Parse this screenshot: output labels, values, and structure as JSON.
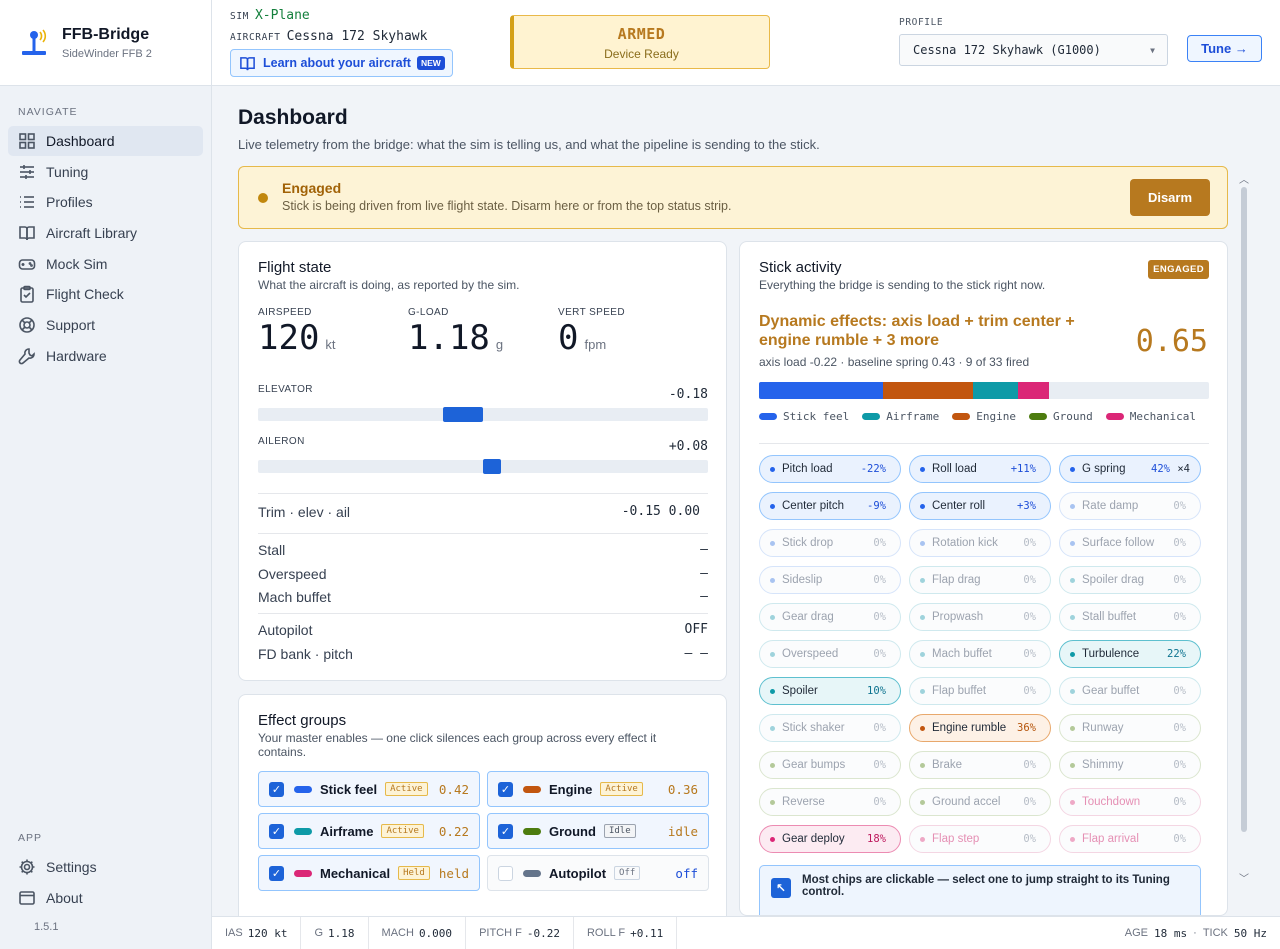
{
  "brand": {
    "title": "FFB-Bridge",
    "subtitle": "SideWinder FFB 2"
  },
  "nav": {
    "heading": "NAVIGATE",
    "items": [
      {
        "label": "Dashboard",
        "icon": "dashboard-icon"
      },
      {
        "label": "Tuning",
        "icon": "sliders-icon"
      },
      {
        "label": "Profiles",
        "icon": "list-icon"
      },
      {
        "label": "Aircraft Library",
        "icon": "book-icon"
      },
      {
        "label": "Mock Sim",
        "icon": "gamepad-icon"
      },
      {
        "label": "Flight Check",
        "icon": "clipboard-icon"
      },
      {
        "label": "Support",
        "icon": "lifebuoy-icon"
      },
      {
        "label": "Hardware",
        "icon": "wrench-icon"
      }
    ],
    "app_heading": "APP",
    "app_items": [
      {
        "label": "Settings",
        "icon": "gear-icon"
      },
      {
        "label": "About",
        "icon": "window-icon"
      }
    ],
    "version": "1.5.1"
  },
  "header": {
    "sim_key": "SIM",
    "sim_value": "X-Plane",
    "aircraft_key": "AIRCRAFT",
    "aircraft_value": "Cessna 172 Skyhawk",
    "learn_label": "Learn about your aircraft",
    "learn_badge": "NEW",
    "armed_title": "ARMED",
    "armed_sub": "Device Ready",
    "profile_label": "PROFILE",
    "profile_value": "Cessna 172 Skyhawk (G1000)",
    "tune_label": "Tune →"
  },
  "page": {
    "title": "Dashboard",
    "subtitle": "Live telemetry from the bridge: what the sim is telling us, and what the pipeline is sending to the stick."
  },
  "engaged": {
    "title": "Engaged",
    "sub": "Stick is being driven from live flight state. Disarm here or from the top status strip.",
    "button": "Disarm"
  },
  "flight_state": {
    "title": "Flight state",
    "sub": "What the aircraft is doing, as reported by the sim.",
    "airspeed": {
      "label": "AIRSPEED",
      "value": "120",
      "unit": "kt"
    },
    "gload": {
      "label": "G-LOAD",
      "value": "1.18",
      "unit": "g"
    },
    "vs": {
      "label": "VERT SPEED",
      "value": "0",
      "unit": "fpm"
    },
    "elevator": {
      "label": "ELEVATOR",
      "value": "-0.18",
      "pos": -0.18
    },
    "aileron": {
      "label": "AILERON",
      "value": "+0.08",
      "pos": 0.08
    },
    "trim": {
      "label": "Trim · elev · ail",
      "value": "-0.15 0.00"
    },
    "stall": {
      "label": "Stall",
      "value": "—"
    },
    "overspeed": {
      "label": "Overspeed",
      "value": "—"
    },
    "mach": {
      "label": "Mach buffet",
      "value": "—"
    },
    "autopilot": {
      "label": "Autopilot",
      "value": "OFF"
    },
    "fd": {
      "label": "FD bank · pitch",
      "value": "— —"
    }
  },
  "effect_groups": {
    "title": "Effect groups",
    "sub": "Your master enables — one click silences each group across every effect it contains.",
    "items": [
      {
        "name": "Stick feel",
        "badge": "Active",
        "value": "0.42",
        "color": "#2563eb",
        "checked": true
      },
      {
        "name": "Engine",
        "badge": "Active",
        "value": "0.36",
        "color": "#c2560f",
        "checked": true
      },
      {
        "name": "Airframe",
        "badge": "Active",
        "value": "0.22",
        "color": "#0e9aa7",
        "checked": true
      },
      {
        "name": "Ground",
        "badge": "Idle",
        "value": "idle",
        "color": "#4d7c0f",
        "checked": true
      },
      {
        "name": "Mechanical",
        "badge": "Held",
        "value": "held",
        "color": "#db2777",
        "checked": true
      },
      {
        "name": "Autopilot",
        "badge": "Off",
        "value": "off",
        "color": "#64748b",
        "checked": false
      }
    ]
  },
  "stick_activity": {
    "title": "Stick activity",
    "sub": "Everything the bridge is sending to the stick right now.",
    "badge": "ENGAGED",
    "dynamic_title": "Dynamic effects: axis load + trim center + engine rumble + 3 more",
    "dynamic_value": "0.65",
    "dynamic_sub": "axis load -0.22 · baseline spring 0.43 · 9 of 33 fired",
    "bar": [
      {
        "group": "Stick feel",
        "fraction": 0.275,
        "color": "#2563eb"
      },
      {
        "group": "Engine",
        "fraction": 0.2,
        "color": "#c2560f"
      },
      {
        "group": "Airframe",
        "fraction": 0.1,
        "color": "#0e9aa7"
      },
      {
        "group": "Mechanical",
        "fraction": 0.07,
        "color": "#db2777"
      }
    ],
    "legend": [
      {
        "label": "Stick feel",
        "color": "#2563eb"
      },
      {
        "label": "Airframe",
        "color": "#0e9aa7"
      },
      {
        "label": "Engine",
        "color": "#c2560f"
      },
      {
        "label": "Ground",
        "color": "#4d7c0f"
      },
      {
        "label": "Mechanical",
        "color": "#db2777"
      }
    ],
    "chips": [
      {
        "name": "Pitch load",
        "value": "-22%",
        "group": "stick",
        "on": true
      },
      {
        "name": "Roll load",
        "value": "+11%",
        "group": "stick",
        "on": true
      },
      {
        "name": "G spring",
        "value": "42%",
        "mult": "×4",
        "group": "stick",
        "on": true
      },
      {
        "name": "Center pitch",
        "value": "-9%",
        "group": "stick",
        "on": true
      },
      {
        "name": "Center roll",
        "value": "+3%",
        "group": "stick",
        "on": true
      },
      {
        "name": "Rate damp",
        "value": "0%",
        "group": "stick",
        "on": false
      },
      {
        "name": "Stick drop",
        "value": "0%",
        "group": "stick",
        "on": false
      },
      {
        "name": "Rotation kick",
        "value": "0%",
        "group": "stick",
        "on": false
      },
      {
        "name": "Surface follow",
        "value": "0%",
        "group": "stick",
        "on": false
      },
      {
        "name": "Sideslip",
        "value": "0%",
        "group": "stick",
        "on": false
      },
      {
        "name": "Flap drag",
        "value": "0%",
        "group": "air",
        "on": false
      },
      {
        "name": "Spoiler drag",
        "value": "0%",
        "group": "air",
        "on": false
      },
      {
        "name": "Gear drag",
        "value": "0%",
        "group": "air",
        "on": false
      },
      {
        "name": "Propwash",
        "value": "0%",
        "group": "air",
        "on": false
      },
      {
        "name": "Stall buffet",
        "value": "0%",
        "group": "air",
        "on": false
      },
      {
        "name": "Overspeed",
        "value": "0%",
        "group": "air",
        "on": false
      },
      {
        "name": "Mach buffet",
        "value": "0%",
        "group": "air",
        "on": false
      },
      {
        "name": "Turbulence",
        "value": "22%",
        "group": "air",
        "on": true
      },
      {
        "name": "Spoiler",
        "value": "10%",
        "group": "air",
        "on": true
      },
      {
        "name": "Flap buffet",
        "value": "0%",
        "group": "air",
        "on": false
      },
      {
        "name": "Gear buffet",
        "value": "0%",
        "group": "air",
        "on": false
      },
      {
        "name": "Stick shaker",
        "value": "0%",
        "group": "air",
        "on": false
      },
      {
        "name": "Engine rumble",
        "value": "36%",
        "group": "eng",
        "on": true
      },
      {
        "name": "Runway",
        "value": "0%",
        "group": "gnd",
        "on": false
      },
      {
        "name": "Gear bumps",
        "value": "0%",
        "group": "gnd",
        "on": false
      },
      {
        "name": "Brake",
        "value": "0%",
        "group": "gnd",
        "on": false
      },
      {
        "name": "Shimmy",
        "value": "0%",
        "group": "gnd",
        "on": false
      },
      {
        "name": "Reverse",
        "value": "0%",
        "group": "gnd",
        "on": false
      },
      {
        "name": "Ground accel",
        "value": "0%",
        "group": "gnd",
        "on": false
      },
      {
        "name": "Touchdown",
        "value": "0%",
        "group": "mech",
        "on": false
      },
      {
        "name": "Gear deploy",
        "value": "18%",
        "group": "mech",
        "on": true
      },
      {
        "name": "Flap step",
        "value": "0%",
        "group": "mech",
        "on": false
      },
      {
        "name": "Flap arrival",
        "value": "0%",
        "group": "mech",
        "on": false
      }
    ],
    "tip": "Most chips are clickable — select one to jump straight to its Tuning control."
  },
  "footer": {
    "ias_key": "IAS",
    "ias": "120 kt",
    "g_key": "G",
    "g": "1.18",
    "mach_key": "MACH",
    "mach": "0.000",
    "pitch_key": "PITCH F",
    "pitch": "-0.22",
    "roll_key": "ROLL F",
    "roll": "+0.11",
    "age_key": "AGE",
    "age": "18 ms",
    "tick_key": "TICK",
    "tick": "50 Hz"
  }
}
